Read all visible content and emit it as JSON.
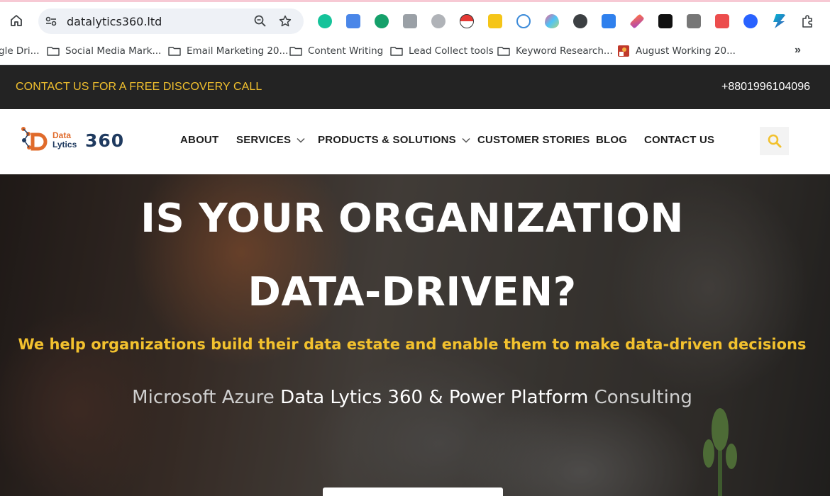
{
  "browser": {
    "url": "datalytics360.ltd",
    "extensions": [
      "grammarly-icon",
      "translate-icon",
      "grammar-g-icon",
      "camera-icon",
      "globe-icon",
      "pokeball-icon",
      "ahrefs-icon",
      "r-icon",
      "heart-icon",
      "spy-icon",
      "arrow-box-icon",
      "pen-icon",
      "chatgpt-icon",
      "qr-icon",
      "pdf-icon",
      "alien-icon",
      "bolt-icon",
      "puzzle-icon"
    ],
    "bookmarks": [
      {
        "label": "gle Dri..."
      },
      {
        "label": "Social Media Mark..."
      },
      {
        "label": "Email Marketing 20..."
      },
      {
        "label": "Content Writing"
      },
      {
        "label": "Lead Collect tools"
      },
      {
        "label": "Keyword Research..."
      },
      {
        "label": "August Working 20..."
      }
    ],
    "more": "»"
  },
  "topbar": {
    "cta": "CONTACT US FOR A FREE DISCOVERY CALL",
    "phone": "+8801996104096"
  },
  "nav": {
    "logo": {
      "data": "Data",
      "lytics": "Lytics",
      "num": "360"
    },
    "items": [
      {
        "label": "ABOUT"
      },
      {
        "label": "SERVICES"
      },
      {
        "label": "PRODUCTS & SOLUTIONS"
      },
      {
        "label": "CUSTOMER STORIES"
      },
      {
        "label": "BLOG"
      },
      {
        "label": "CONTACT US"
      }
    ]
  },
  "hero": {
    "title_line1": "IS YOUR ORGANIZATION",
    "title_line2": "DATA-DRIVEN?",
    "subtitle": "We help organizations build their data estate and enable them to make data-driven decisions",
    "line_part1": "Microsoft Azure ",
    "line_part2": "Data Lytics 360 & Power Platform",
    "line_part3": " Consulting"
  },
  "colors": {
    "accent_yellow": "#f2c12e",
    "topbar_bg": "#232323",
    "logo_orange": "#e06b2b",
    "logo_navy": "#1f3a5f"
  }
}
